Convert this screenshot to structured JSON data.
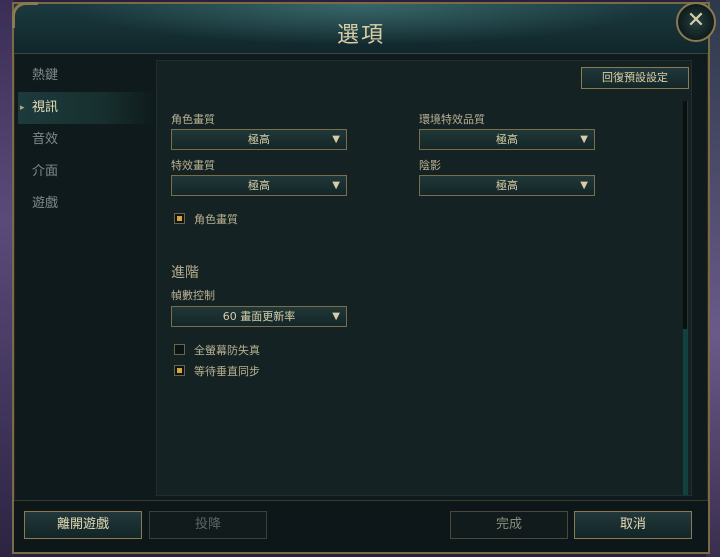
{
  "window": {
    "title": "選項",
    "close_label": "✕"
  },
  "sidebar": {
    "items": [
      {
        "label": "熱鍵",
        "active": false
      },
      {
        "label": "視訊",
        "active": true
      },
      {
        "label": "音效",
        "active": false
      },
      {
        "label": "介面",
        "active": false
      },
      {
        "label": "遊戲",
        "active": false
      }
    ]
  },
  "video": {
    "reset_label": "回復預設設定",
    "character_quality": {
      "label": "角色畫質",
      "value": "極高"
    },
    "environment_quality": {
      "label": "環境特效品質",
      "value": "極高"
    },
    "effects_quality": {
      "label": "特效畫質",
      "value": "極高"
    },
    "shadows": {
      "label": "陰影",
      "value": "極高"
    },
    "character_inking": {
      "label": "角色畫質",
      "checked": true
    },
    "advanced_heading": "進階",
    "frame_rate": {
      "label": "幀數控制",
      "value": "60 畫面更新率"
    },
    "anti_aliasing": {
      "label": "全螢幕防失真",
      "checked": false
    },
    "vsync": {
      "label": "等待垂直同步",
      "checked": true
    }
  },
  "footer": {
    "leave_label": "離開遊戲",
    "surrender_label": "投降",
    "done_label": "完成",
    "cancel_label": "取消"
  },
  "colors": {
    "accent_gold": "#8a7a50",
    "checkbox_fill": "#d8a63a",
    "panel_bg": "#142224"
  }
}
